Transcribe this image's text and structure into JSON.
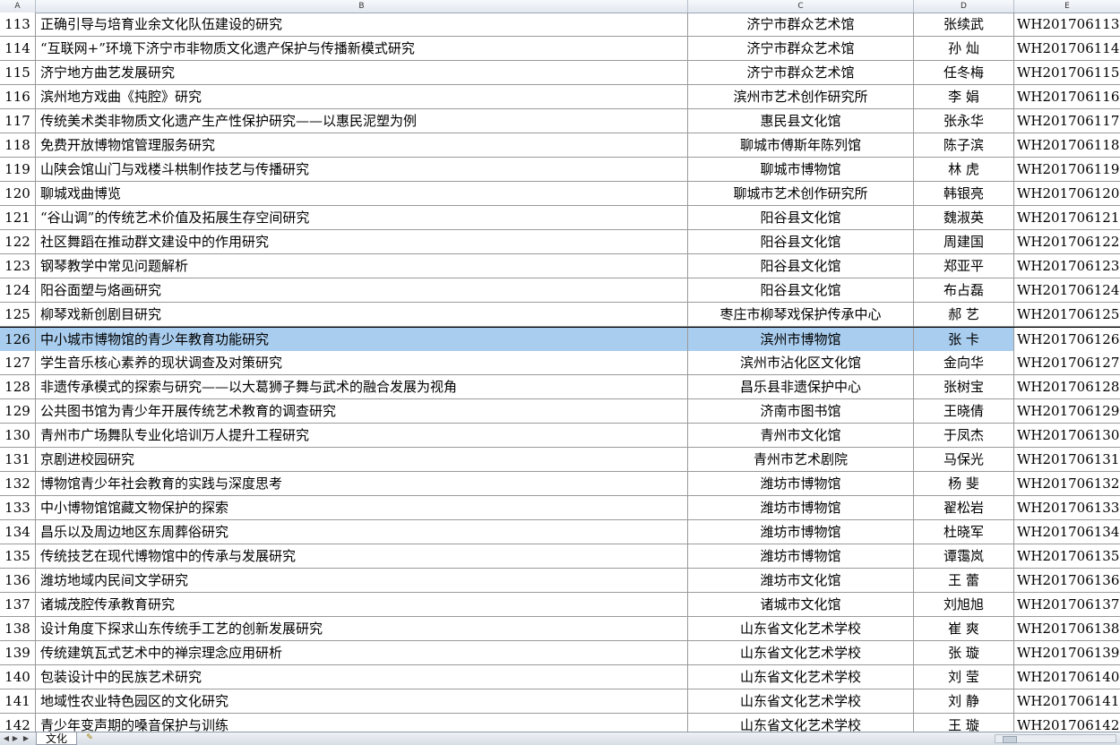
{
  "columns": [
    "A",
    "B",
    "C",
    "D",
    "E"
  ],
  "selected_row": "126",
  "rows": [
    {
      "num": "113",
      "title": "正确引导与培育业余文化队伍建设的研究",
      "org": "济宁市群众艺术馆",
      "name": "张续武",
      "code": "WH201706113"
    },
    {
      "num": "114",
      "title": "“互联网+”环境下济宁市非物质文化遗产保护与传播新模式研究",
      "org": "济宁市群众艺术馆",
      "name": "孙  灿",
      "code": "WH201706114"
    },
    {
      "num": "115",
      "title": "济宁地方曲艺发展研究",
      "org": "济宁市群众艺术馆",
      "name": "任冬梅",
      "code": "WH201706115"
    },
    {
      "num": "116",
      "title": "滨州地方戏曲《扽腔》研究",
      "org": "滨州市艺术创作研究所",
      "name": "李  娟",
      "code": "WH201706116"
    },
    {
      "num": "117",
      "title": "传统美术类非物质文化遗产生产性保护研究——以惠民泥塑为例",
      "org": "惠民县文化馆",
      "name": "张永华",
      "code": "WH201706117"
    },
    {
      "num": "118",
      "title": "免费开放博物馆管理服务研究",
      "org": "聊城市傅斯年陈列馆",
      "name": "陈子滨",
      "code": "WH201706118"
    },
    {
      "num": "119",
      "title": "山陕会馆山门与戏楼斗栱制作技艺与传播研究",
      "org": "聊城市博物馆",
      "name": "林  虎",
      "code": "WH201706119"
    },
    {
      "num": "120",
      "title": "聊城戏曲博览",
      "org": "聊城市艺术创作研究所",
      "name": "韩银亮",
      "code": "WH201706120"
    },
    {
      "num": "121",
      "title": "“谷山调”的传统艺术价值及拓展生存空间研究",
      "org": "阳谷县文化馆",
      "name": "魏淑英",
      "code": "WH201706121"
    },
    {
      "num": "122",
      "title": "社区舞蹈在推动群文建设中的作用研究",
      "org": "阳谷县文化馆",
      "name": "周建国",
      "code": "WH201706122"
    },
    {
      "num": "123",
      "title": "钢琴教学中常见问题解析",
      "org": "阳谷县文化馆",
      "name": "郑亚平",
      "code": "WH201706123"
    },
    {
      "num": "124",
      "title": "阳谷面塑与烙画研究",
      "org": "阳谷县文化馆",
      "name": "布占磊",
      "code": "WH201706124"
    },
    {
      "num": "125",
      "title": "柳琴戏新创剧目研究",
      "org": "枣庄市柳琴戏保护传承中心",
      "name": "郝  艺",
      "code": "WH201706125"
    },
    {
      "num": "126",
      "title": "中小城市博物馆的青少年教育功能研究",
      "org": "滨州市博物馆",
      "name": "张  卡",
      "code": "WH201706126"
    },
    {
      "num": "127",
      "title": "学生音乐核心素养的现状调查及对策研究",
      "org": "滨州市沾化区文化馆",
      "name": "金向华",
      "code": "WH201706127"
    },
    {
      "num": "128",
      "title": "非遗传承模式的探索与研究——以大葛狮子舞与武术的融合发展为视角",
      "org": "昌乐县非遗保护中心",
      "name": "张树宝",
      "code": "WH201706128"
    },
    {
      "num": "129",
      "title": "公共图书馆为青少年开展传统艺术教育的调查研究",
      "org": "济南市图书馆",
      "name": "王晓倩",
      "code": "WH201706129"
    },
    {
      "num": "130",
      "title": "青州市广场舞队专业化培训万人提升工程研究",
      "org": "青州市文化馆",
      "name": "于凤杰",
      "code": "WH201706130"
    },
    {
      "num": "131",
      "title": "京剧进校园研究",
      "org": "青州市艺术剧院",
      "name": "马保光",
      "code": "WH201706131"
    },
    {
      "num": "132",
      "title": "博物馆青少年社会教育的实践与深度思考",
      "org": "潍坊市博物馆",
      "name": "杨  斐",
      "code": "WH201706132"
    },
    {
      "num": "133",
      "title": "中小博物馆馆藏文物保护的探索",
      "org": "潍坊市博物馆",
      "name": "翟松岩",
      "code": "WH201706133"
    },
    {
      "num": "134",
      "title": "昌乐以及周边地区东周葬俗研究",
      "org": "潍坊市博物馆",
      "name": "杜晓军",
      "code": "WH201706134"
    },
    {
      "num": "135",
      "title": "传统技艺在现代博物馆中的传承与发展研究",
      "org": "潍坊市博物馆",
      "name": "谭霭岚",
      "code": "WH201706135"
    },
    {
      "num": "136",
      "title": "潍坊地域内民间文学研究",
      "org": "潍坊市文化馆",
      "name": "王  蕾",
      "code": "WH201706136"
    },
    {
      "num": "137",
      "title": "诸城茂腔传承教育研究",
      "org": "诸城市文化馆",
      "name": "刘旭旭",
      "code": "WH201706137"
    },
    {
      "num": "138",
      "title": "设计角度下探求山东传统手工艺的创新发展研究",
      "org": "山东省文化艺术学校",
      "name": "崔  爽",
      "code": "WH201706138"
    },
    {
      "num": "139",
      "title": "传统建筑瓦式艺术中的禅宗理念应用研析",
      "org": "山东省文化艺术学校",
      "name": "张  璇",
      "code": "WH201706139"
    },
    {
      "num": "140",
      "title": "包装设计中的民族艺术研究",
      "org": "山东省文化艺术学校",
      "name": "刘  莹",
      "code": "WH201706140"
    },
    {
      "num": "141",
      "title": "地域性农业特色园区的文化研究",
      "org": "山东省文化艺术学校",
      "name": "刘  静",
      "code": "WH201706141"
    },
    {
      "num": "142",
      "title": "青少年变声期的嗓音保护与训练",
      "org": "山东省文化艺术学校",
      "name": "王  璇",
      "code": "WH201706142"
    }
  ],
  "sheet_tabs": [
    "文化"
  ]
}
